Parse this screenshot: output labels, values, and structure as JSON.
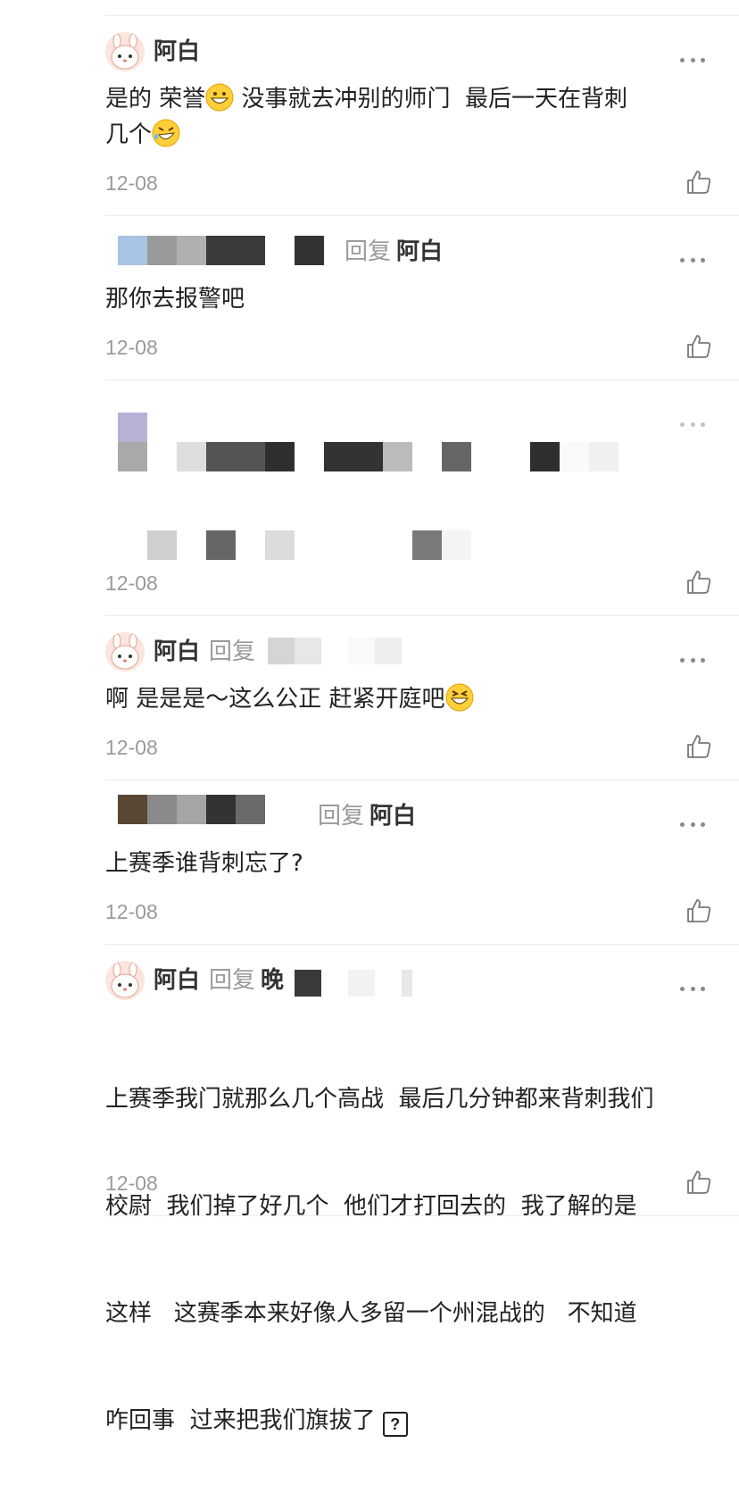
{
  "comments": [
    {
      "user": "阿白",
      "text": "是的 荣誉",
      "text_b": " 没事就去冲别的师门  最后一天在背刺",
      "text_c": "几个",
      "date": "12-08"
    },
    {
      "reply_label": "回复",
      "reply_to": "阿白",
      "text": "那你去报警吧",
      "date": "12-08"
    },
    {
      "date": "12-08"
    },
    {
      "user": "阿白",
      "reply_label": "回复",
      "text": "啊 是是是～这么公正 赶紧开庭吧",
      "date": "12-08"
    },
    {
      "reply_label": "回复",
      "reply_to": "阿白",
      "text": "上赛季谁背刺忘了?",
      "date": "12-08"
    },
    {
      "user": "阿白",
      "reply_label": "回复",
      "reply_partial": "晚",
      "lines": [
        "上赛季我门就那么几个高战  最后几分钟都来背刺我们",
        "校尉  我们掉了好几个  他们才打回去的  我了解的是",
        "这样   这赛季本来好像人多留一个州混战的   不知道",
        "咋回事  过来把我们旗拔了"
      ],
      "question_glyph": "?",
      "date": "12-08"
    }
  ],
  "icons": {
    "more": "more-dots-icon",
    "like": "thumbs-up-icon",
    "grin": "grinning-emoji-icon",
    "rofl": "rofl-emoji-icon",
    "laugh": "laughing-emoji-icon"
  },
  "colors": {
    "username": "#333333",
    "meta": "#9a9a9a",
    "divider": "#ececec"
  }
}
